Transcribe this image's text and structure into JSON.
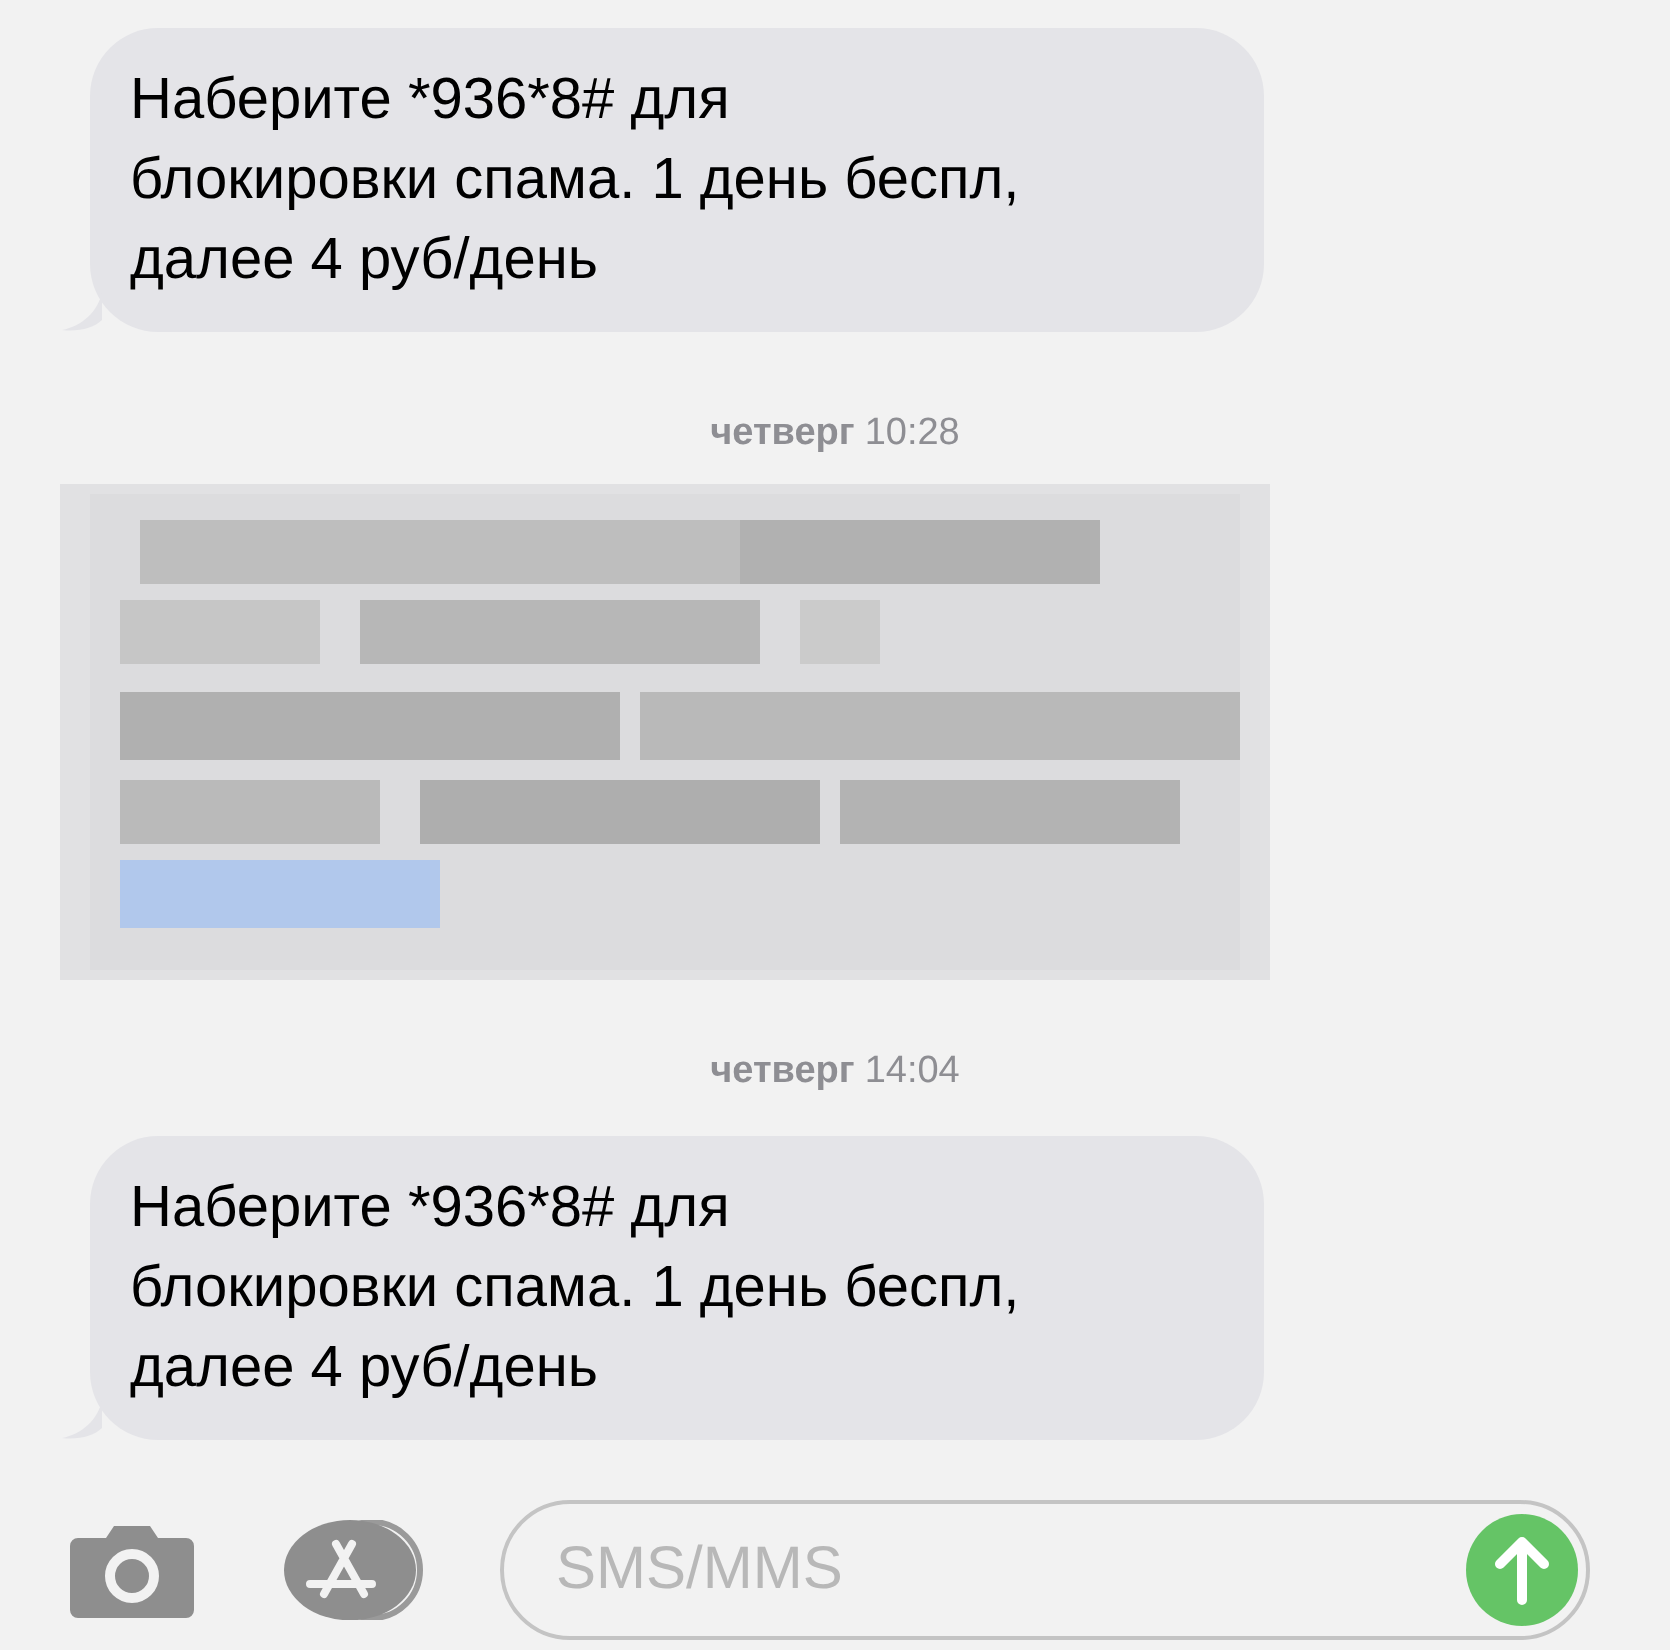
{
  "thread": [
    {
      "kind": "message",
      "text": "Наберите *936*8# для\nблокировки спама. 1 день беспл,\nдалее 4 руб/день"
    },
    {
      "kind": "timestamp",
      "day": "четверг",
      "time": "10:28"
    },
    {
      "kind": "redacted"
    },
    {
      "kind": "timestamp",
      "day": "четверг",
      "time": "14:04"
    },
    {
      "kind": "message",
      "text": "Наберите *936*8# для\nблокировки спама. 1 день беспл,\nдалее 4 руб/день"
    }
  ],
  "composer": {
    "placeholder": "SMS/MMS",
    "send_enabled": true
  }
}
